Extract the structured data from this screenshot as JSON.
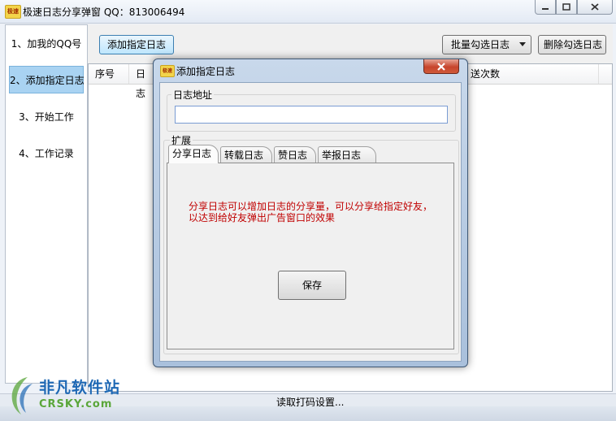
{
  "window": {
    "logo_text": "极速",
    "title": "极速日志分享弹窗 QQ：813006494"
  },
  "sidebar": {
    "items": [
      {
        "label": "1、加我的QQ号"
      },
      {
        "label": "2、添加指定日志"
      },
      {
        "label": "3、开始工作"
      },
      {
        "label": "4、工作记录"
      }
    ],
    "active_index": 1
  },
  "toolbar": {
    "add_label": "添加指定日志",
    "batch_select_label": "批量勾选日志",
    "delete_label": "删除勾选日志"
  },
  "table": {
    "columns": [
      "序号",
      "日志",
      "送次数"
    ]
  },
  "status": {
    "text": "读取打码设置..."
  },
  "watermark": {
    "line1": "非凡软件站",
    "line2": "CRSKY.com"
  },
  "dialog": {
    "logo_text": "极速",
    "title": "添加指定日志",
    "address_group_label": "日志地址",
    "address_value": "",
    "extend_group_label": "扩展",
    "tabs": [
      {
        "label": "分享日志"
      },
      {
        "label": "转载日志"
      },
      {
        "label": "赞日志"
      },
      {
        "label": "举报日志"
      }
    ],
    "active_tab": 0,
    "tab_description_line1": "分享日志可以增加日志的分享量，可以分享给指定好友，",
    "tab_description_line2": "以达到给好友弹出广告窗口的效果",
    "save_label": "保存"
  },
  "colors": {
    "active_nav": "#a9d3f2",
    "description_text": "#c00000",
    "dialog_close": "#c7452c"
  }
}
